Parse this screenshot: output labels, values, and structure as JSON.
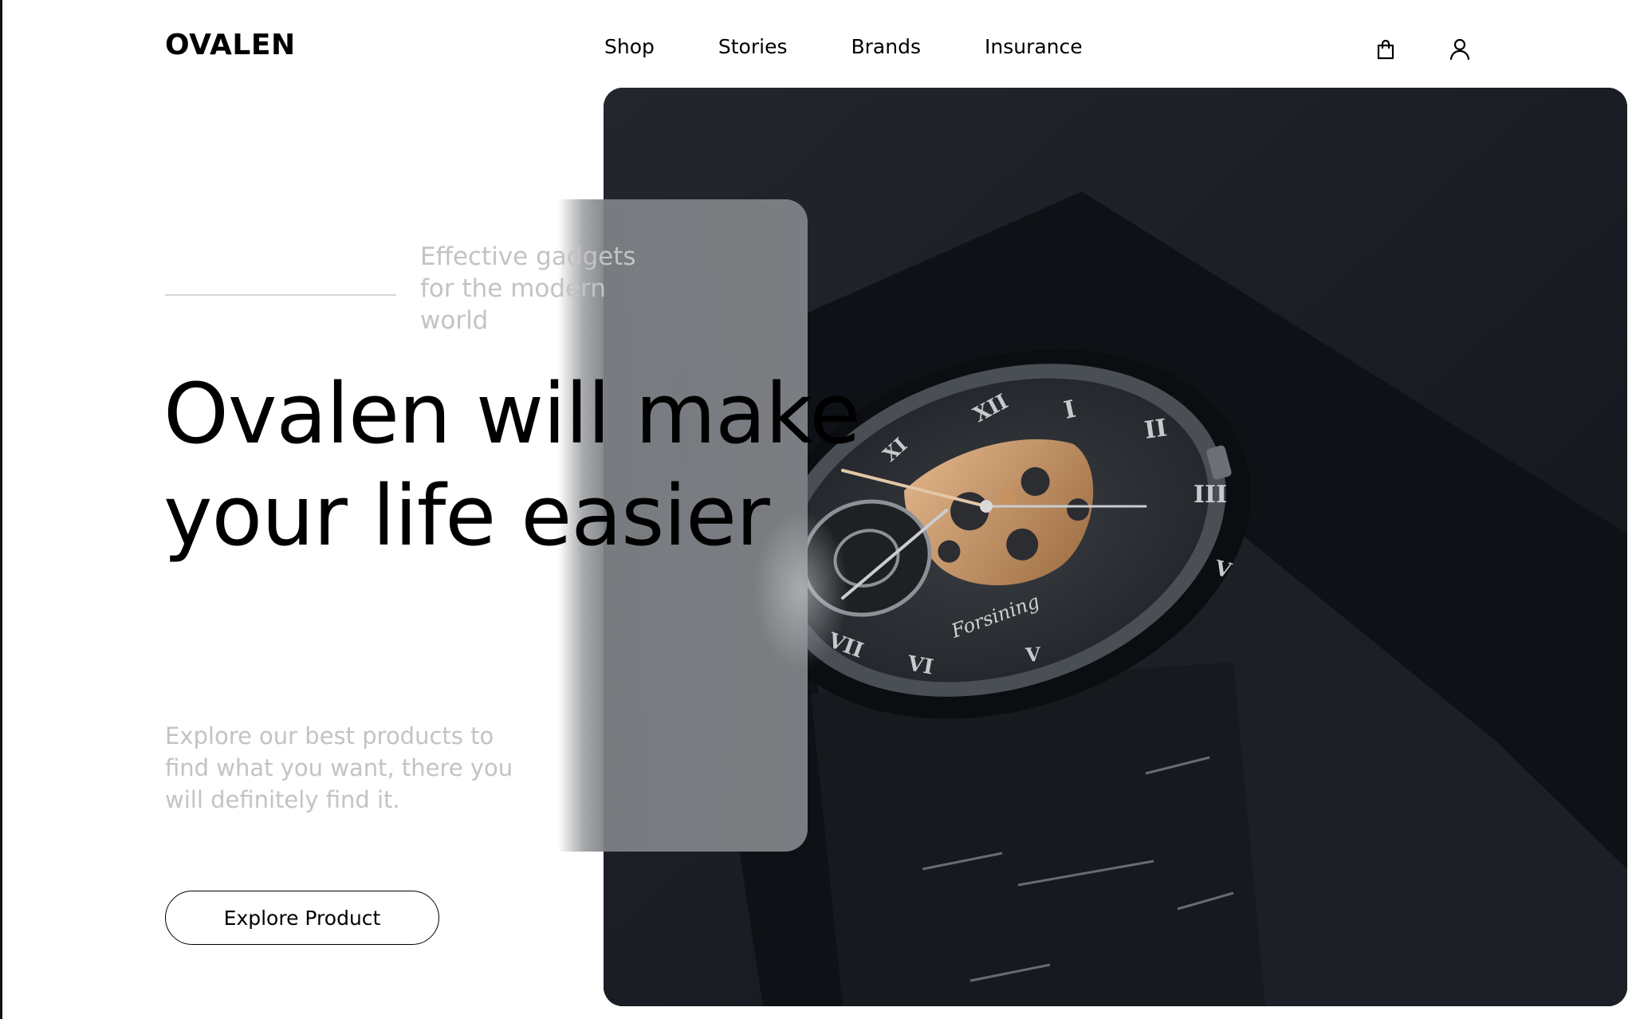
{
  "brand": {
    "logo": "OVALEN"
  },
  "nav": {
    "items": [
      "Shop",
      "Stories",
      "Brands",
      "Insurance"
    ]
  },
  "icons": {
    "cart": "shopping-bag-icon",
    "account": "user-icon"
  },
  "hero": {
    "tagline": "Effective gadgets for the modern world",
    "headline": "Ovalen will make your life easier",
    "description": "Explore our best products to find what you want, there you will definitely find it.",
    "cta": "Explore Product",
    "image": {
      "subject": "skeleton-watch-photo",
      "watch_brand": "Forsining"
    }
  },
  "colors": {
    "background": "#ffffff",
    "text": "#000000",
    "muted_text": "#c3c3c3",
    "photo_dark": "#181c22",
    "watch_gold": "#c8925e",
    "glass_panel": "#7a7d81"
  }
}
